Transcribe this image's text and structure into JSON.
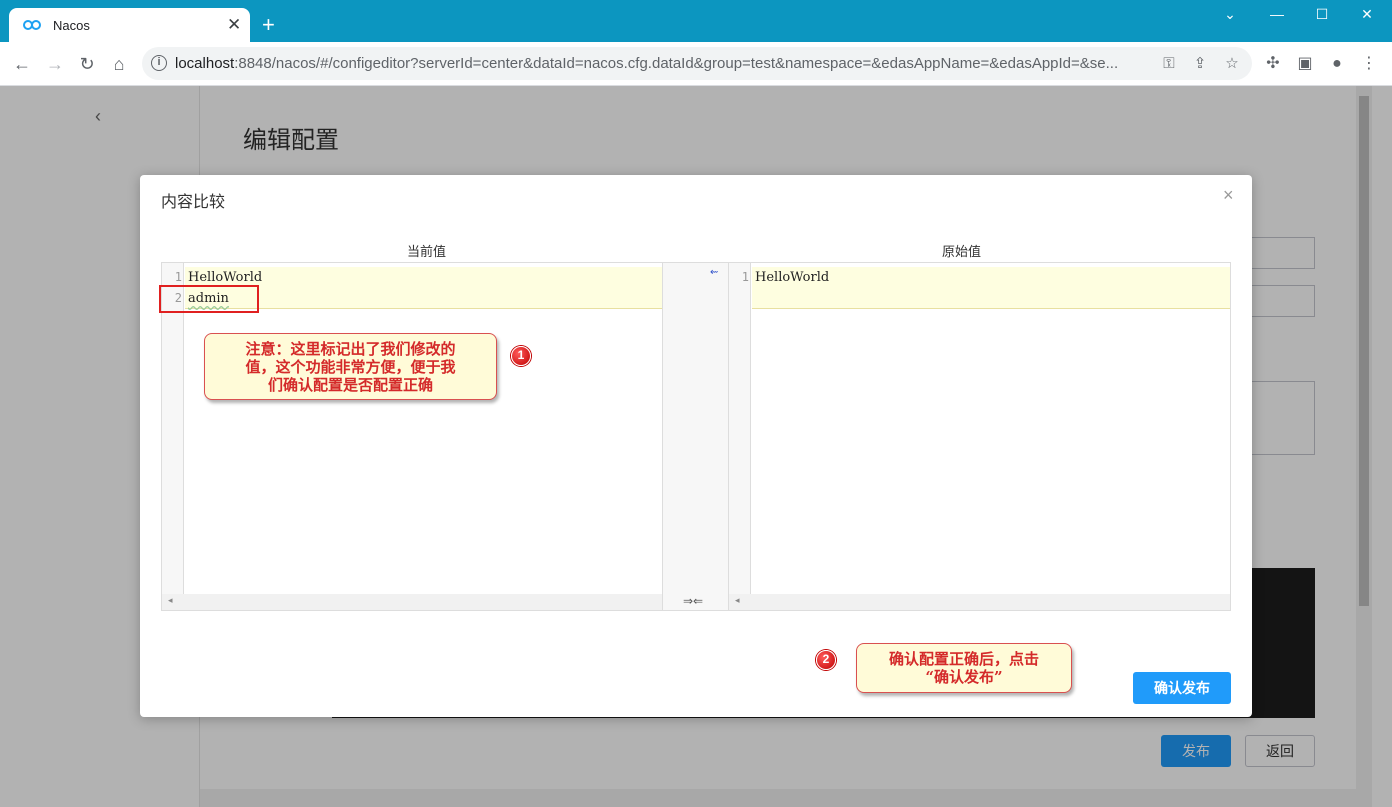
{
  "browser": {
    "tab_title": "Nacos",
    "tab_close": "✕",
    "new_tab": "+",
    "url_host": "localhost",
    "url_rest": ":8848/nacos/#/configeditor?serverId=center&dataId=nacos.cfg.dataId&group=test&namespace=&edasAppName=&edasAppId=&se...",
    "window_controls": [
      "minimize",
      "maximize",
      "close"
    ]
  },
  "page": {
    "back_icon": "‹",
    "title": "编辑配置",
    "publish_label": "发布",
    "return_label": "返回"
  },
  "dialog": {
    "title": "内容比较",
    "close": "×",
    "current_header": "当前值",
    "original_header": "原始值",
    "current_lines": [
      {
        "no": "1",
        "text": "HelloWorld"
      },
      {
        "no": "2",
        "text": "admin"
      }
    ],
    "original_lines": [
      {
        "no": "1",
        "text": "HelloWorld"
      }
    ],
    "merge_arrow": "⇜",
    "swap_icon": "⇒⇐",
    "confirm_label": "确认发布"
  },
  "annotations": {
    "note1": "注意：这里标记出了我们修改的值，这个功能非常方便，便于我们确认配置是否配置正确",
    "note1_lines": [
      "注意：这里标记出了我们修改的",
      "值，这个功能非常方便，便于我",
      "们确认配置是否配置正确"
    ],
    "badge1": "1",
    "note2_lines": [
      "确认配置正确后，点击",
      "“确认发布”"
    ],
    "badge2": "2"
  },
  "colors": {
    "chrome_bg": "#0c96c0",
    "primary_button": "#209bfa",
    "diff_highlight": "#fefee0",
    "annotation_red": "#d42a2a"
  }
}
